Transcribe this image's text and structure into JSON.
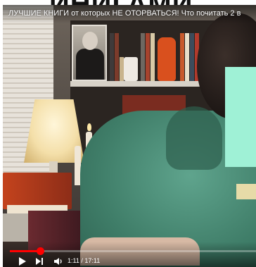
{
  "page": {
    "overflow_text": "ИНИГАМИ"
  },
  "video": {
    "title": "ЛУЧШИЕ КНИГИ от которых НЕ ОТОРВАТЬСЯ! Что почитать 2 в"
  },
  "player": {
    "progress_fraction": 0.122,
    "current_time": "1:11",
    "separator": " / ",
    "duration": "17:11",
    "accent_color": "#ff0000"
  },
  "icons": {
    "play": "play-icon",
    "next": "next-icon",
    "volume": "volume-icon"
  },
  "overlay": {
    "mask_color": "#9ff1d6"
  }
}
